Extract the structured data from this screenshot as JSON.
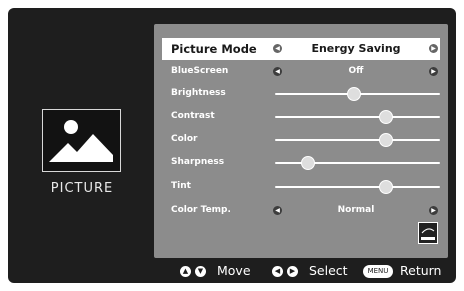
{
  "category": {
    "label": "PICTURE",
    "icon": "picture-icon"
  },
  "menu": {
    "items": [
      {
        "label": "Picture Mode",
        "value": "Energy Saving",
        "kind": "select"
      },
      {
        "label": "BlueScreen",
        "value": "Off",
        "kind": "select"
      },
      {
        "label": "Brightness",
        "level": 0.48,
        "kind": "slider"
      },
      {
        "label": "Contrast",
        "level": 0.67,
        "kind": "slider"
      },
      {
        "label": "Color",
        "level": 0.67,
        "kind": "slider"
      },
      {
        "label": "Sharpness",
        "level": 0.2,
        "kind": "slider"
      },
      {
        "label": "Tint",
        "level": 0.67,
        "kind": "slider"
      },
      {
        "label": "Color Temp.",
        "value": "Normal",
        "kind": "select"
      }
    ]
  },
  "hints": {
    "move": "Move",
    "select": "Select",
    "menu_key": "MENU",
    "return": "Return"
  },
  "colors": {
    "frame": "#1e1e1e",
    "panel": "#8c8c8c",
    "highlight": "#ffffff"
  }
}
